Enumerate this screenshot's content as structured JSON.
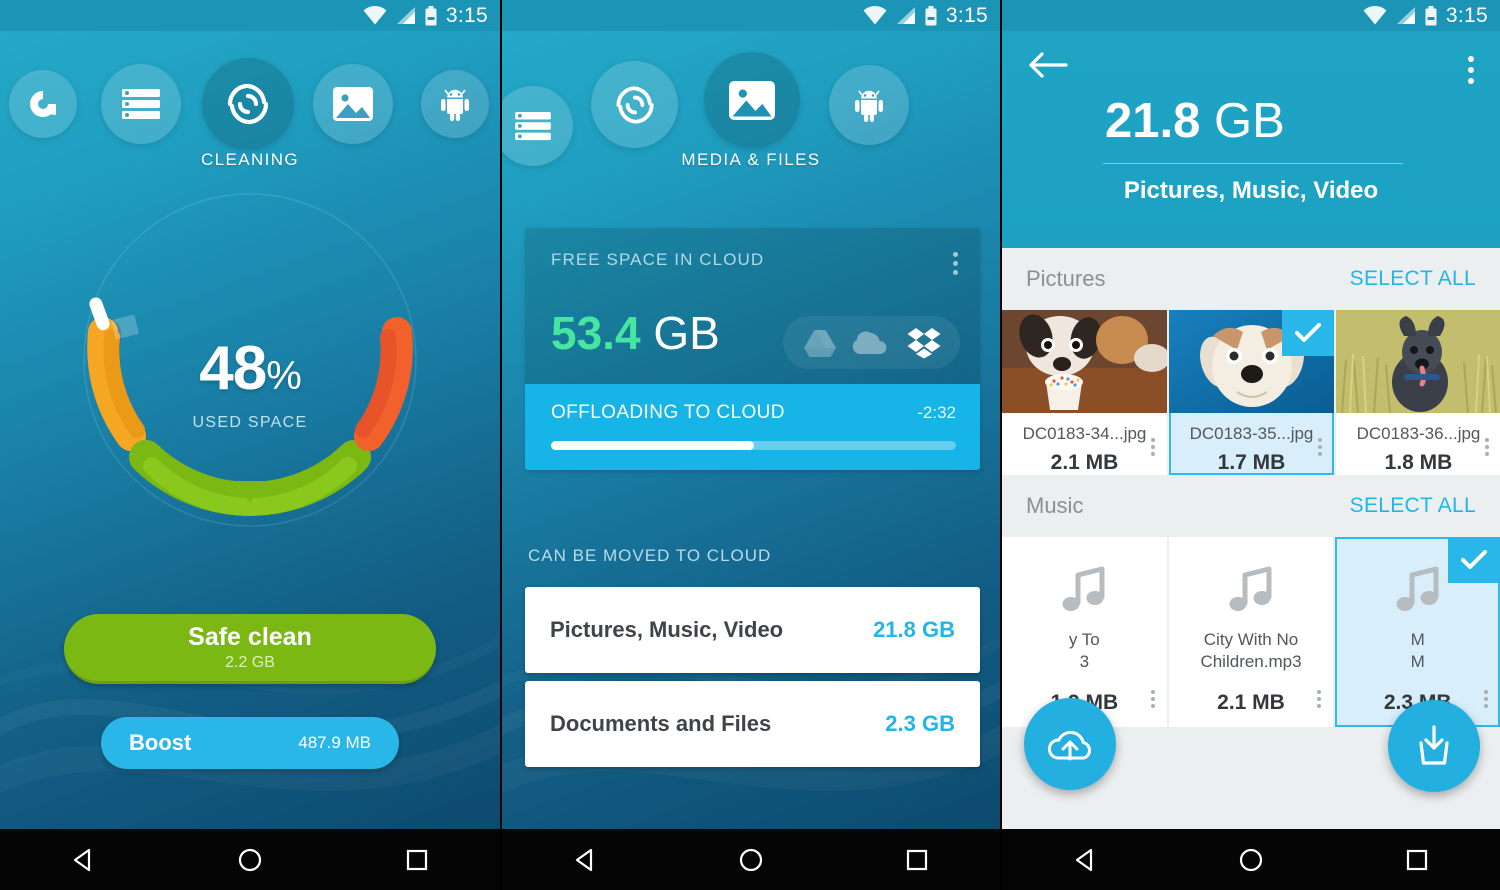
{
  "status_bar": {
    "time": "3:15",
    "icons": [
      "wifi-icon",
      "signal-icon",
      "battery-icon"
    ]
  },
  "colors": {
    "teal": "#1f9ec0",
    "cyan_accent": "#23b5e8",
    "green": "#7cb814",
    "green_bright": "#46e6a0",
    "orange": "#f5a623",
    "red_orange": "#f2612c",
    "selected_tile_bg": "#d9eefb"
  },
  "screen1": {
    "nav_items": [
      {
        "name": "avast-logo",
        "label": ""
      },
      {
        "name": "storage-list-icon",
        "label": ""
      },
      {
        "name": "cleaning-fan-icon",
        "label": "CLEANING",
        "active": true
      },
      {
        "name": "media-photo-icon",
        "label": ""
      },
      {
        "name": "android-apps-icon",
        "label": ""
      }
    ],
    "active_label": "CLEANING",
    "gauge": {
      "percent": "48",
      "percent_unit": "%",
      "caption": "USED SPACE"
    },
    "safe_clean": {
      "label": "Safe clean",
      "size": "2.2 GB"
    },
    "boost": {
      "label": "Boost",
      "size": "487.9 MB"
    }
  },
  "screen2": {
    "nav_items": [
      {
        "name": "storage-list-icon",
        "label": ""
      },
      {
        "name": "cleaning-fan-icon",
        "label": ""
      },
      {
        "name": "media-photo-icon",
        "label": "MEDIA & FILES",
        "active": true
      },
      {
        "name": "android-apps-icon",
        "label": ""
      }
    ],
    "active_label": "MEDIA & FILES",
    "cloud_card": {
      "header": "FREE SPACE IN CLOUD",
      "amount_number": "53.4",
      "amount_unit": "GB",
      "providers": [
        "google-drive-icon",
        "onedrive-icon",
        "dropbox-icon"
      ],
      "active_provider": "dropbox-icon",
      "offload_label": "OFFLOADING TO CLOUD",
      "offload_eta": "-2:32",
      "progress_percent": 50
    },
    "section_header": "CAN BE MOVED TO CLOUD",
    "rows": [
      {
        "name": "Pictures, Music, Video",
        "size": "21.8 GB"
      },
      {
        "name": "Documents and Files",
        "size": "2.3 GB"
      }
    ]
  },
  "screen3": {
    "back_icon": "arrow-left-icon",
    "overflow_icon": "kebab-menu-icon",
    "amount_number": "21.8",
    "amount_unit": "GB",
    "subtitle": "Pictures, Music, Video",
    "groups": [
      {
        "title": "Pictures",
        "select_all": "SELECT ALL",
        "items": [
          {
            "filename": "DC0183-34...jpg",
            "size": "2.1 MB",
            "selected": false,
            "thumb": "puppy-cupcake"
          },
          {
            "filename": "DC0183-35...jpg",
            "size": "1.7 MB",
            "selected": true,
            "thumb": "dog-blue-bg"
          },
          {
            "filename": "DC0183-36...jpg",
            "size": "1.8 MB",
            "selected": false,
            "thumb": "dog-field"
          }
        ]
      },
      {
        "title": "Music",
        "select_all": "SELECT ALL",
        "items": [
          {
            "filename": "y To\n3",
            "size": "1.9 MB",
            "selected": false,
            "thumb": "music-note-icon"
          },
          {
            "filename": "City With No\nChildren.mp3",
            "size": "2.1 MB",
            "selected": false,
            "thumb": "music-note-icon"
          },
          {
            "filename": "M\nM",
            "size": "2.3 MB",
            "selected": true,
            "thumb": "music-note-icon"
          }
        ]
      }
    ],
    "fabs": [
      {
        "name": "upload-to-cloud-fab",
        "icon": "cloud-upload-icon"
      },
      {
        "name": "download-to-device-fab",
        "icon": "download-tray-icon"
      }
    ]
  },
  "navbar": {
    "buttons": [
      "back-triangle-icon",
      "home-circle-icon",
      "recents-square-icon"
    ]
  }
}
